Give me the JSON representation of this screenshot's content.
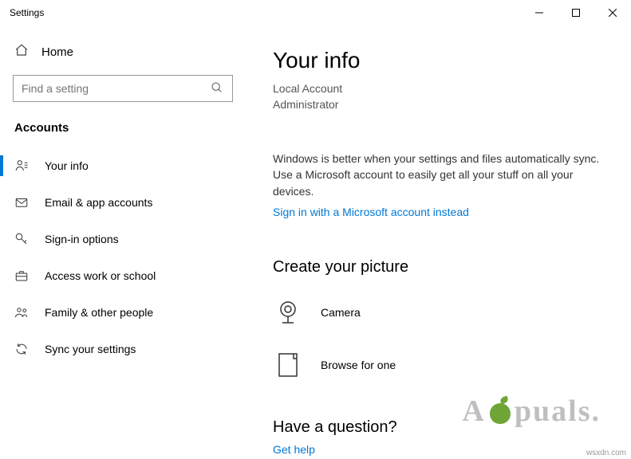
{
  "titlebar": {
    "title": "Settings"
  },
  "sidebar": {
    "home_label": "Home",
    "search_placeholder": "Find a setting",
    "section": "Accounts",
    "items": [
      {
        "label": "Your info",
        "selected": true
      },
      {
        "label": "Email & app accounts",
        "selected": false
      },
      {
        "label": "Sign-in options",
        "selected": false
      },
      {
        "label": "Access work or school",
        "selected": false
      },
      {
        "label": "Family & other people",
        "selected": false
      },
      {
        "label": "Sync your settings",
        "selected": false
      }
    ]
  },
  "content": {
    "page_title": "Your info",
    "account_type": "Local Account",
    "account_role": "Administrator",
    "sync_text": "Windows is better when your settings and files automatically sync. Use a Microsoft account to easily get all your stuff on all your devices.",
    "signin_link": "Sign in with a Microsoft account instead",
    "picture_title": "Create your picture",
    "camera_label": "Camera",
    "browse_label": "Browse for one",
    "question_title": "Have a question?",
    "help_link": "Get help"
  },
  "watermark": {
    "text_before": "A",
    "text_after": "puals."
  },
  "credit": "wsxdn.com"
}
